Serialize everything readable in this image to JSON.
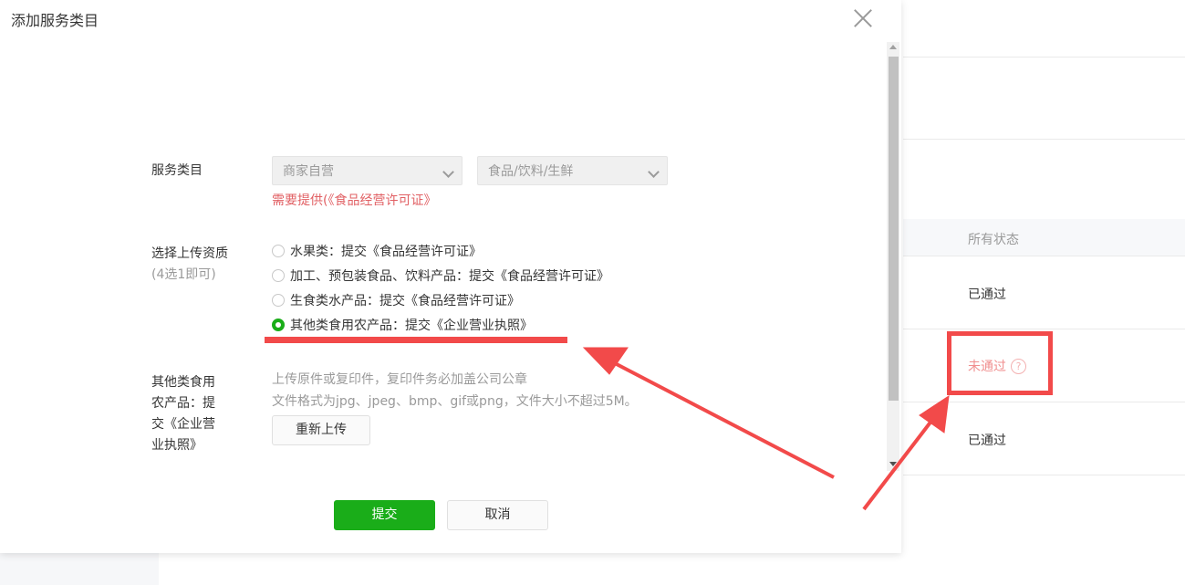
{
  "dialog": {
    "title": "添加服务类目",
    "close_icon": "close-icon"
  },
  "form": {
    "category_label": "服务类目",
    "category_select_1": "商家自营",
    "category_select_2": "食品/饮料/生鲜",
    "category_requirement": "需要提供(《食品经营许可证》",
    "qualification_label": "选择上传资质",
    "qualification_sub": "(4选1即可)",
    "options": [
      {
        "label": "水果类：提交《食品经营许可证》",
        "selected": false
      },
      {
        "label": "加工、预包装食品、饮料产品：提交《食品经营许可证》",
        "selected": false
      },
      {
        "label": "生食类水产品：提交《食品经营许可证》",
        "selected": false
      },
      {
        "label": "其他类食用农产品：提交《企业营业执照》",
        "selected": true
      }
    ],
    "upload_label_lines": [
      "其他类食用",
      "农产品：提",
      "交《企业营",
      "业执照》"
    ],
    "upload_hint_1": "上传原件或复印件，复印件务必加盖公司公章",
    "upload_hint_2": "文件格式为jpg、jpeg、bmp、gif或png，文件大小不超过5M。",
    "reupload_button": "重新上传",
    "submit_button": "提交",
    "cancel_button": "取消"
  },
  "background_table": {
    "status_header": "所有状态",
    "rows": [
      "已通过",
      "未通过",
      "已通过"
    ],
    "help_icon_glyph": "?"
  },
  "colors": {
    "primary_green": "#1aad19",
    "warning_red": "#e15f63",
    "annotation_red": "#f24a4a"
  }
}
